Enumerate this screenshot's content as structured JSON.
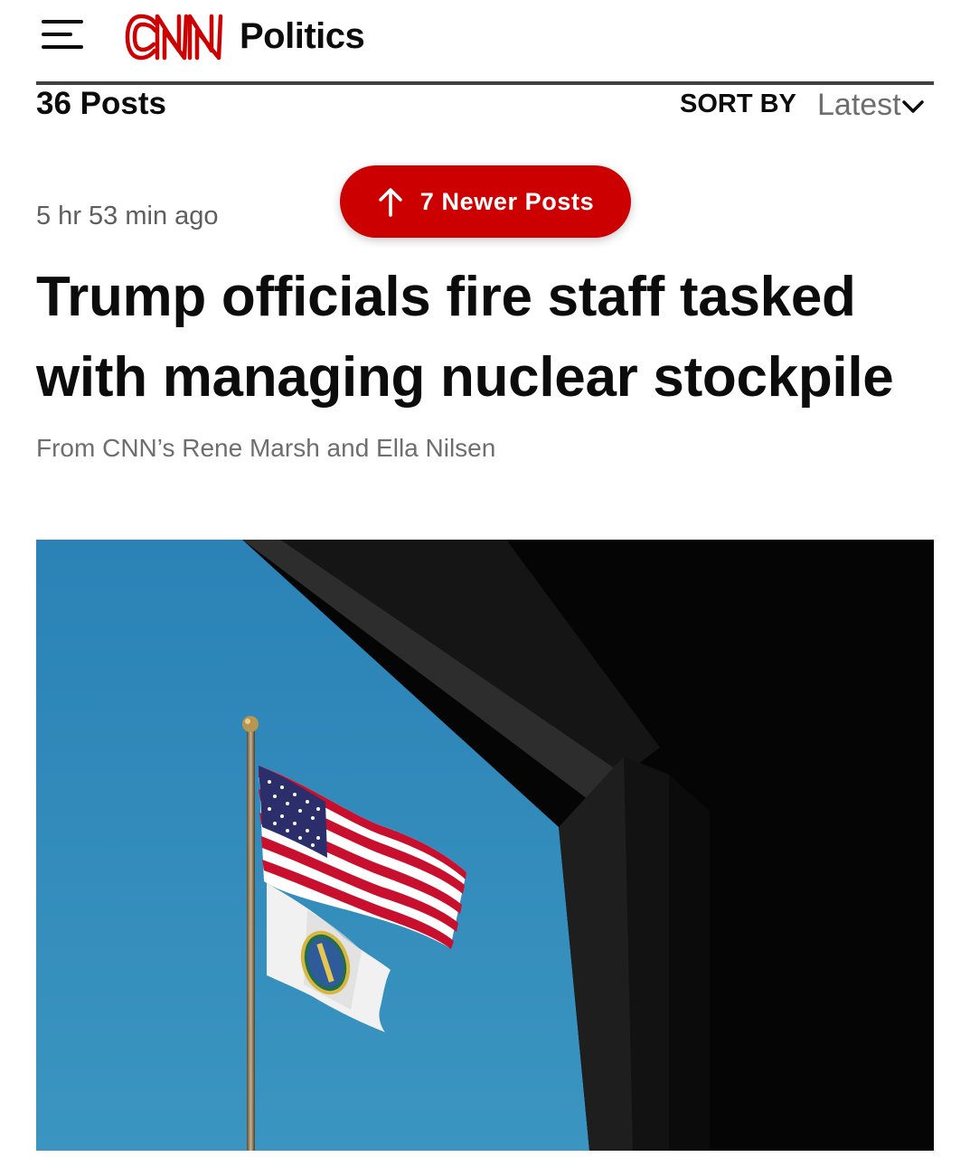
{
  "header": {
    "menu_icon": "hamburger-menu-icon",
    "logo_text": "CNN",
    "section": "Politics",
    "brand_color": "#cc0000"
  },
  "feed": {
    "posts_count": "36 Posts",
    "sort_label": "SORT BY",
    "sort_value": "Latest",
    "sort_icon": "chevron-down-icon"
  },
  "newer_posts": {
    "label": "7 Newer Posts",
    "icon": "arrow-up-icon"
  },
  "post": {
    "timestamp": "5 hr 53 min ago",
    "headline": "Trump officials fire staff tasked with managing nuclear stockpile",
    "byline": "From CNN’s Rene Marsh and Ella Nilsen"
  }
}
